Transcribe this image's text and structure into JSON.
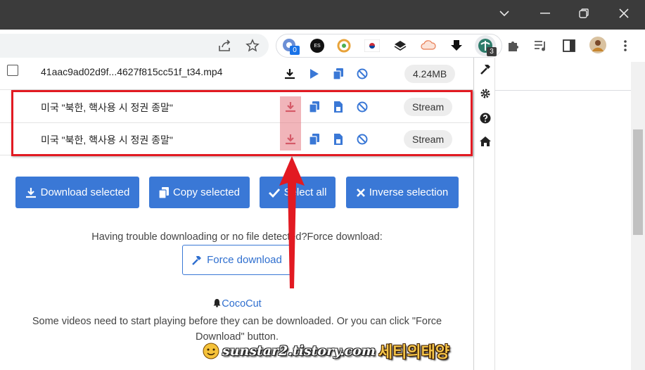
{
  "titlebar": {
    "minimize": "─",
    "restore": "❐",
    "close": "✕",
    "chevron": "⌄"
  },
  "toolbar": {
    "ext_badges": {
      "first": "0",
      "active": "3"
    },
    "es_label": "ES"
  },
  "downloader": {
    "rows": [
      {
        "title": "41aac9ad02d9f...4627f815cc51f_t34.mp4",
        "size": "4.24MB"
      },
      {
        "title": "미국 \"북한, 핵사용 시 정권 종말\"",
        "size": "Stream"
      },
      {
        "title": "미국 \"북한, 핵사용 시 정권 종말\"",
        "size": "Stream"
      }
    ],
    "buttons": {
      "download_selected": "Download selected",
      "copy_selected": "Copy selected",
      "select_all": "Select all",
      "inverse_selection": "Inverse selection"
    },
    "trouble_text": "Having trouble downloading or no file detected?Force download:",
    "force_download": "Force download",
    "brand": "CocoCut",
    "hint_line1": "Some videos need to start playing before they can be downloaded. Or you can click \"Force",
    "hint_line2": "Download\" button."
  },
  "watermark": {
    "site": "sunstar2.tistory.com",
    "name": "세티의태양"
  },
  "colors": {
    "accent": "#3a78d6",
    "highlight": "#e21a22",
    "titlebar": "#3b3b3b"
  }
}
